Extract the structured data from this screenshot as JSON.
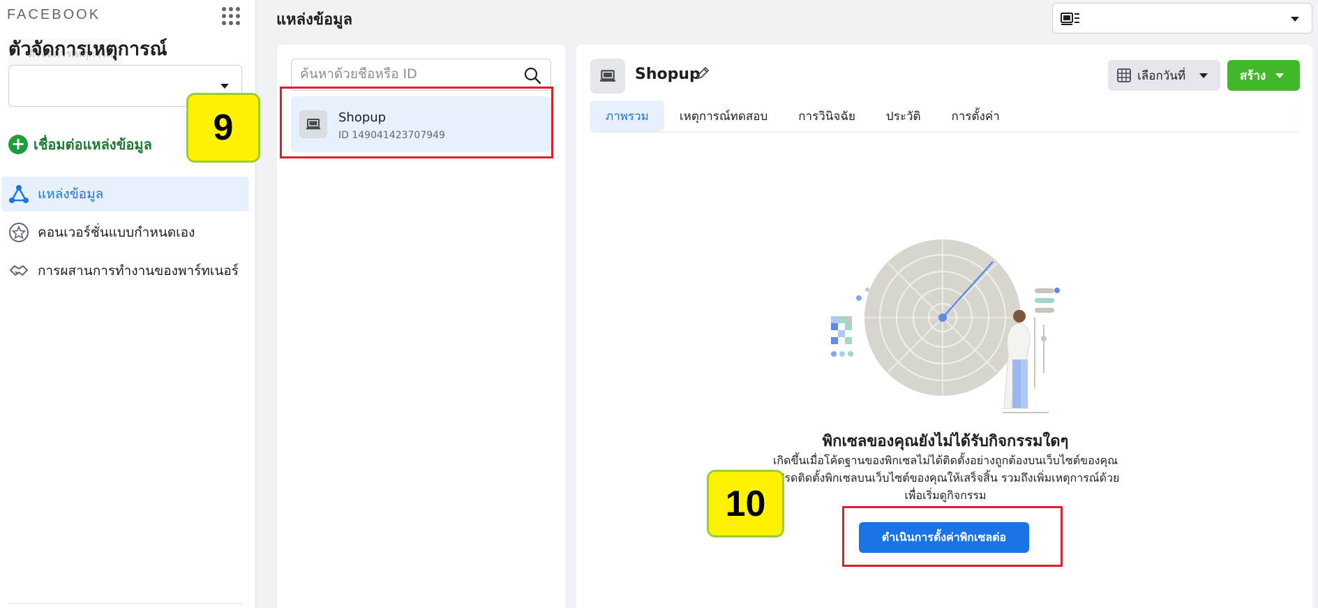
{
  "sidebar": {
    "brand": "FACEBOOK",
    "app_title": "ตัวจัดการเหตุการณ์",
    "ghost_text": "ตัวจัดการเหตุการณ์",
    "connect_label": "เชื่อมต่อแหล่งข้อมูล",
    "nav_items": [
      {
        "label": "แหล่งข้อมูล",
        "icon": "data-sources-icon",
        "active": true
      },
      {
        "label": "คอนเวอร์ชั่นแบบกำหนดเอง",
        "icon": "star-circle-icon",
        "active": false
      },
      {
        "label": "การผสานการทำงานของพาร์ทเนอร์",
        "icon": "handshake-icon",
        "active": false
      }
    ]
  },
  "header": {
    "title": "แหล่งข้อมูล"
  },
  "source_list": {
    "search_placeholder": "ค้นหาด้วยชื่อหรือ ID",
    "items": [
      {
        "name": "Shopup",
        "id": "ID 149041423707949"
      }
    ]
  },
  "detail": {
    "name": "Shopup",
    "date_button": "เลือกวันที่",
    "create_button": "สร้าง",
    "tabs": [
      "ภาพรวม",
      "เหตุการณ์ทดสอบ",
      "การวินิจฉัย",
      "ประวัติ",
      "การตั้งค่า"
    ],
    "active_tab": "ภาพรวม",
    "empty_title": "พิกเซลของคุณยังไม่ได้รับกิจกรรมใดๆ",
    "empty_desc": "เกิดขึ้นเมื่อโค้ดฐานของพิกเซลไม่ได้ติดตั้งอย่างถูกต้องบนเว็บไซต์ของคุณ โปรดติดตั้งพิกเซลบนเว็บไซต์ของคุณให้เสร็จสิ้น รวมถึงเพิ่มเหตุการณ์ด้วย เพื่อเริ่มดูกิจกรรม",
    "continue_button": "ดำเนินการตั้งค่าพิกเซลต่อ"
  },
  "annotations": {
    "step_9": "9",
    "step_10": "10"
  },
  "colors": {
    "primary": "#1b74e4",
    "create_green": "#42b72a",
    "highlight_red": "#e01e25",
    "badge_yellow": "#fff200"
  }
}
